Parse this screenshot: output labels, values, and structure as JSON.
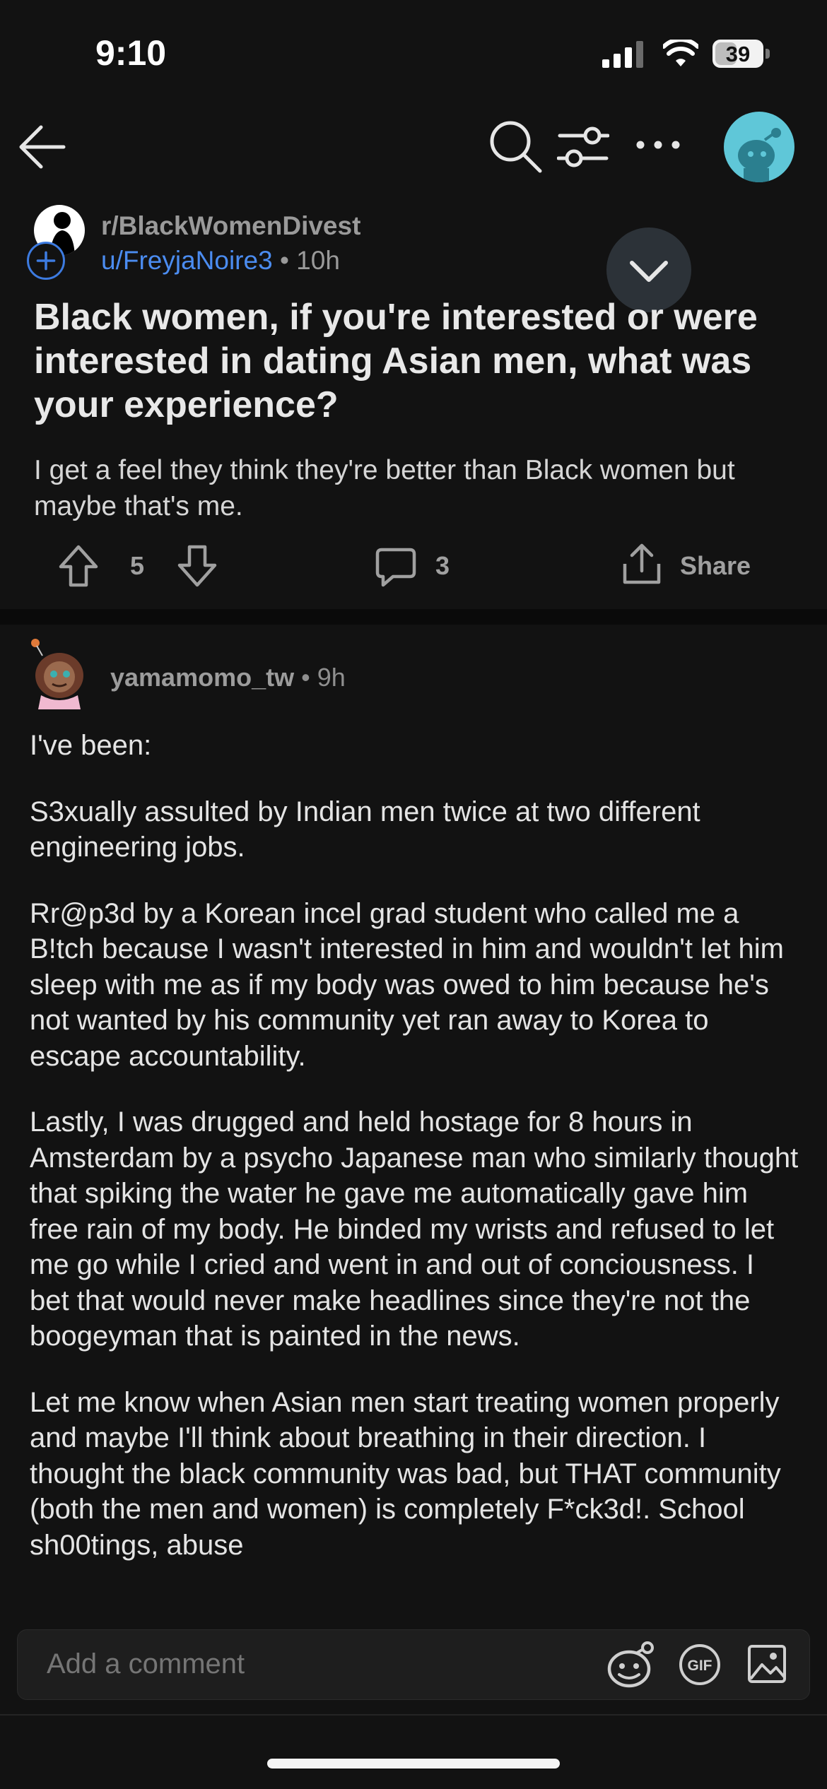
{
  "status_bar": {
    "time": "9:10",
    "battery": "39"
  },
  "nav": {
    "back_icon": "back-arrow-icon",
    "search_icon": "search-icon",
    "filter_icon": "filter-icon",
    "more_icon": "more-icon",
    "avatar_icon": "user-avatar-icon"
  },
  "post": {
    "subreddit": "r/BlackWomenDivest",
    "author": "u/FreyjaNoire3",
    "time": "• 10h",
    "title": "Black women, if you're interested or were interested in dating Asian men, what was your experience?",
    "body": "I get a feel they think they're better than Black women but maybe that's me.",
    "votes": "5",
    "comments": "3",
    "share_label": "Share"
  },
  "comment": {
    "author": "yamamomo_tw",
    "time": "• 9h",
    "paragraphs": [
      "I've been:",
      "S3xually assulted by Indian men twice at two different engineering jobs.",
      "Rr@p3d by a Korean incel grad student who called me a B!tch because I wasn't interested in him and wouldn't let him sleep with me as if my body was owed to him because he's not wanted by his community yet ran away to Korea to escape accountability.",
      "Lastly, I was drugged and held hostage for 8 hours in Amsterdam by a psycho Japanese man who similarly thought that spiking the water he gave me automatically gave him free rain of my body. He binded my wrists and refused to let me go while I cried and went in and out of conciousness. I bet that would never make headlines since they're not the boogeyman that is painted in the news.",
      "Let me know when Asian men start treating women properly and maybe I'll think about breathing in their direction. I thought the black community was bad, but THAT community (both the men and women) is completely F*ck3d!. School sh00tings, abuse"
    ]
  },
  "composer": {
    "placeholder": "Add a comment",
    "gif_label": "GIF"
  }
}
